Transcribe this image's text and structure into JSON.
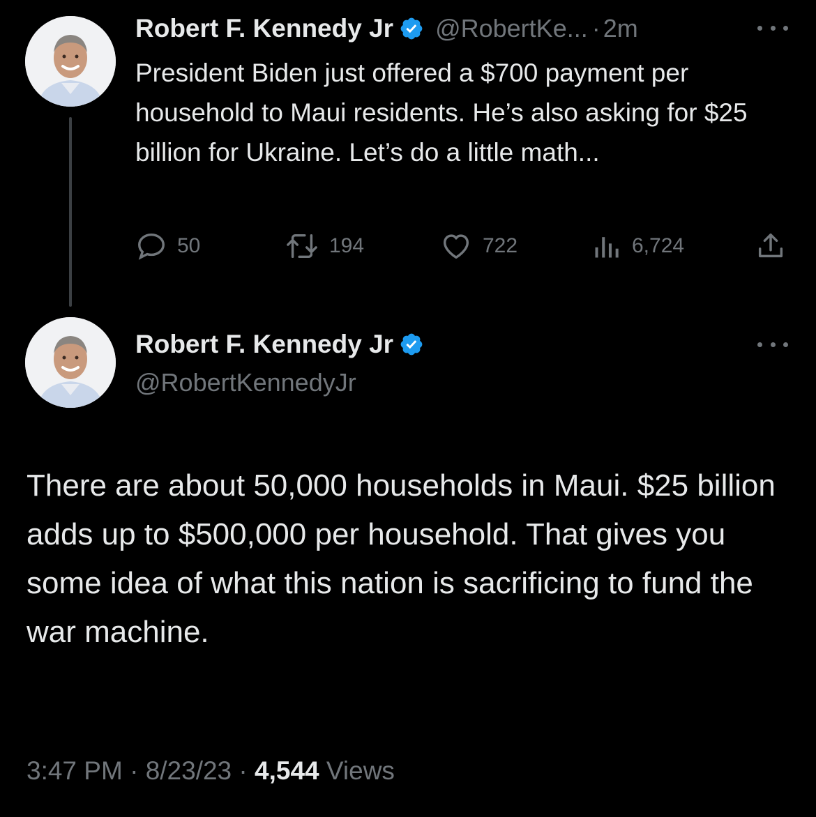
{
  "tweet1": {
    "author_name": "Robert F. Kennedy Jr",
    "handle": "@RobertKe...",
    "separator": "·",
    "time": "2m",
    "text": "President Biden just offered a $700 payment per household to Maui residents. He’s also asking for $25 billion for Ukraine. Let’s do a little math...",
    "replies": "50",
    "retweets": "194",
    "likes": "722",
    "views": "6,724"
  },
  "tweet2": {
    "author_name": "Robert F. Kennedy Jr",
    "handle": "@RobertKennedyJr",
    "text": "There are about 50,000 households in Maui. $25 billion adds up to $500,000 per household. That gives you some idea of what this nation is sacrificing to fund the war machine.",
    "time": "3:47 PM",
    "date": "8/23/23",
    "separator": "·",
    "views_count": "4,544",
    "views_label": "Views"
  },
  "colors": {
    "background": "#000000",
    "text_primary": "#e7e9ea",
    "text_secondary": "#71767b",
    "verified_blue": "#1d9bf0",
    "thread_line": "#3b3f43"
  },
  "icons": {
    "reply": "reply-icon",
    "retweet": "retweet-icon",
    "like": "heart-icon",
    "views": "analytics-icon",
    "share": "share-icon",
    "verified": "verified-badge-icon",
    "more": "more-icon"
  }
}
